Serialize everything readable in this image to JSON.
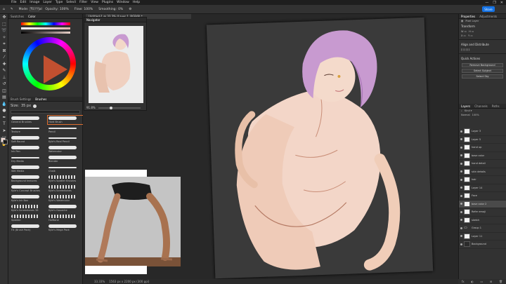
{
  "app": {
    "logo": "Ps"
  },
  "menu": [
    "File",
    "Edit",
    "Image",
    "Layer",
    "Type",
    "Select",
    "Filter",
    "View",
    "Plugins",
    "Window",
    "Help"
  ],
  "window_controls": [
    "—",
    "❐",
    "✕"
  ],
  "options_bar": {
    "tool_icon": "brush-icon",
    "mode_label": "Mode:",
    "mode_value": "Normal",
    "opacity_label": "Opacity:",
    "opacity_value": "100%",
    "flow_label": "Flow:",
    "flow_value": "100%",
    "smoothing_label": "Smoothing:",
    "smoothing_value": "0%",
    "share_label": "Share"
  },
  "color_panel": {
    "tabs": [
      "Swatches",
      "Color"
    ],
    "active_tab": "Color"
  },
  "brush_panel": {
    "tabs": [
      "Brush Settings",
      "Brushes"
    ],
    "active_tab": "Brushes",
    "size_label": "Size:",
    "size_value": "35 px",
    "brushes": [
      {
        "name": "General Brushes",
        "style": "solid"
      },
      {
        "name": "Hard Brush",
        "style": "solid",
        "selected": true
      },
      {
        "name": "Texture",
        "style": "thin"
      },
      {
        "name": "Pencil",
        "style": "thin"
      },
      {
        "name": "Soft Round",
        "style": "solid"
      },
      {
        "name": "Kyle's Real Pencil",
        "style": "thin"
      },
      {
        "name": "Ink Pen",
        "style": "solid"
      },
      {
        "name": "Watercolor",
        "style": "solid"
      },
      {
        "name": "Dry Media",
        "style": "thin"
      },
      {
        "name": "Blender",
        "style": "solid"
      },
      {
        "name": "Wet Media",
        "style": "solid"
      },
      {
        "name": "Chalk",
        "style": "thin"
      },
      {
        "name": "Background textures",
        "style": "solid"
      },
      {
        "name": "Kyle's Spatter Brushes",
        "style": "dots"
      },
      {
        "name": "Kyle's Concept Brushes",
        "style": "solid"
      },
      {
        "name": "Kyle's Screentones",
        "style": "dots"
      },
      {
        "name": "Kyle's Ink Box",
        "style": "solid"
      },
      {
        "name": "Kyle's Watercolor",
        "style": "dots"
      },
      {
        "name": "Kyle's Screentones 38",
        "style": "dots"
      },
      {
        "name": "Kyle's Gouache",
        "style": "solid"
      },
      {
        "name": "Splatter",
        "style": "dots"
      },
      {
        "name": "Halftone",
        "style": "dots"
      },
      {
        "name": "FX (Brush Pack)",
        "style": "solid"
      },
      {
        "name": "Kyle's Mega Pack",
        "style": "solid"
      }
    ]
  },
  "navigator": {
    "title": "Navigator",
    "zoom": "91.8%"
  },
  "document": {
    "tab_title": "Untitled-1 @ 33.3% (Layer 1, RGB/8) *"
  },
  "status_bar": {
    "zoom": "33.33%",
    "info": "1563 px x 2200 px (300 ppi)"
  },
  "right_panel": {
    "properties_title": "Properties",
    "adjustments_title": "Adjustments",
    "pixel_layer": "Pixel Layer",
    "transform_title": "Transform",
    "align_title": "Align and Distribute",
    "quick_actions_title": "Quick Actions",
    "quick_actions": [
      "Remove Background",
      "Select Subject",
      "Select Sky"
    ],
    "layers_tabs": [
      "Layers",
      "Channels",
      "Paths"
    ],
    "blend_mode": "Normal",
    "opacity": "100%",
    "layers": [
      {
        "name": "Layer 3",
        "thumb": "light"
      },
      {
        "name": "Layer 5",
        "thumb": "light"
      },
      {
        "name": "hand up",
        "thumb": "light"
      },
      {
        "name": "base color",
        "thumb": "light"
      },
      {
        "name": "hand detail",
        "thumb": "light"
      },
      {
        "name": "skin details",
        "thumb": "light"
      },
      {
        "name": "hair",
        "thumb": "light"
      },
      {
        "name": "Layer 14",
        "thumb": "light"
      },
      {
        "name": "Face",
        "thumb": "light"
      },
      {
        "name": "base color 2",
        "thumb": "light",
        "selected": true
      },
      {
        "name": "Refer emoji",
        "thumb": "light"
      },
      {
        "name": "sketch",
        "thumb": "light"
      },
      {
        "name": "Group 1",
        "thumb": "folder"
      },
      {
        "name": "Layer 11",
        "thumb": "light"
      },
      {
        "name": "Background",
        "thumb": "dark"
      }
    ],
    "bottom_icons": [
      "fx",
      "◐",
      "▭",
      "⊞",
      "🗑"
    ]
  },
  "colors": {
    "accent": "#1473e6",
    "panel_bg": "#323232",
    "canvas_bg": "#3a3a3a",
    "foreground_color": "#f4dcd4",
    "background_color": "#1a1a1a"
  }
}
